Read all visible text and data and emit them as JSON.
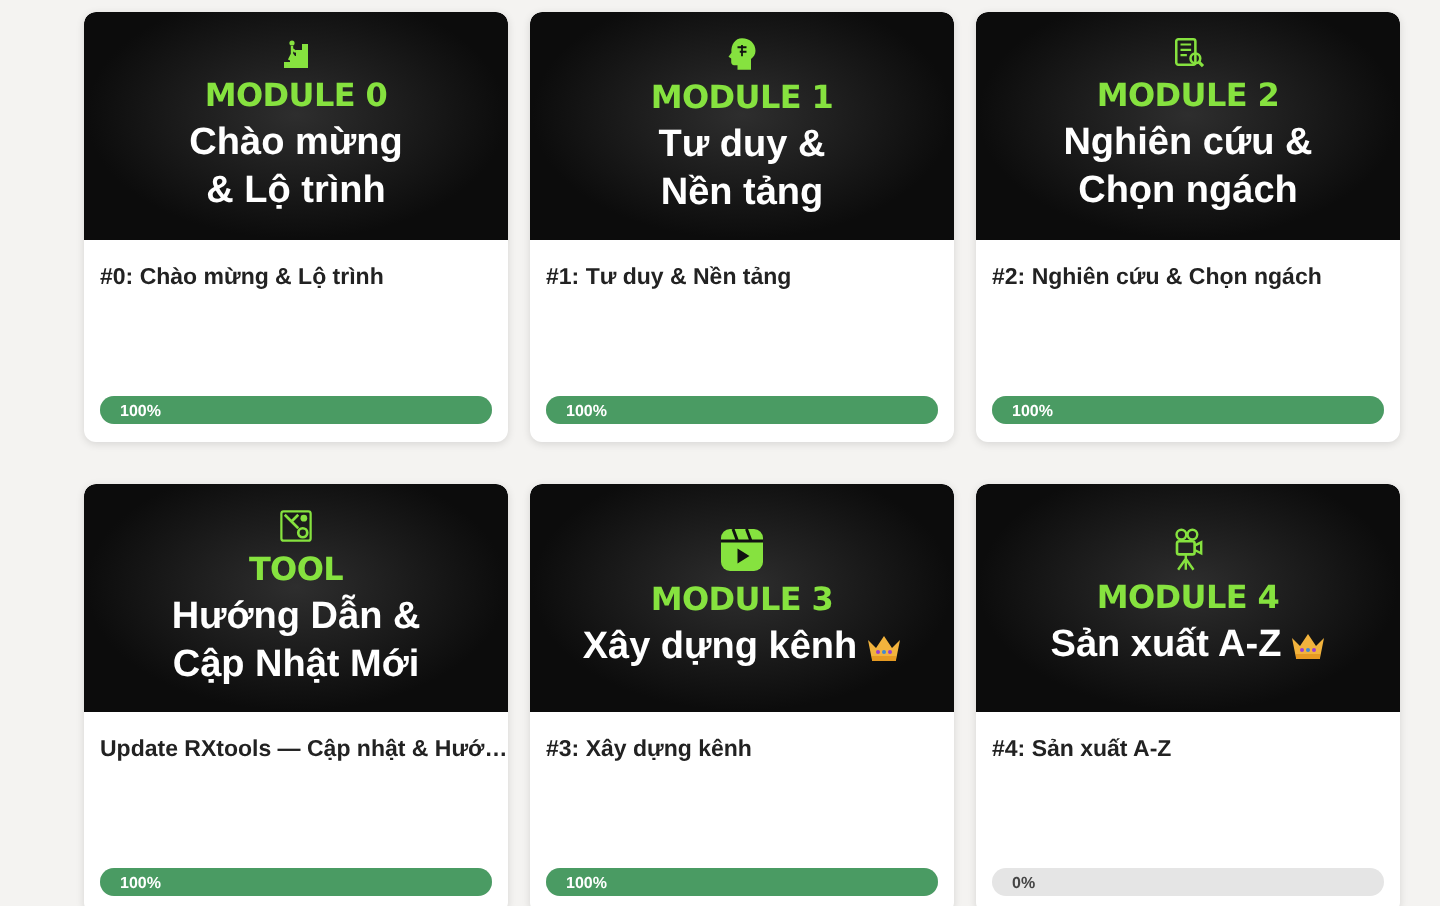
{
  "cards": [
    {
      "kind": "stairs",
      "label": "MODULE 0",
      "heading": "Chào mừng\n& Lộ trình",
      "crown": false,
      "title": "#0: Chào mừng & Lộ trình",
      "level": 1,
      "progress": "100%"
    },
    {
      "kind": "brain",
      "label": "MODULE 1",
      "heading": "Tư duy &\nNền tảng",
      "crown": false,
      "title": "#1: Tư duy & Nền tảng",
      "level": 1,
      "progress": "100%"
    },
    {
      "kind": "document",
      "label": "MODULE 2",
      "heading": "Nghiên cứu &\nChọn ngách",
      "crown": false,
      "title": "#2: Nghiên cứu & Chọn ngách",
      "level": 1,
      "progress": "100%"
    },
    {
      "kind": "tools",
      "label": "TOOL",
      "heading": "Hướng Dẫn &\nCập Nhật Mới",
      "crown": false,
      "title": "Update RXtools — Cập nhật & Hướ…",
      "level": 1,
      "progress": "100%"
    },
    {
      "kind": "video",
      "label": "MODULE 3",
      "heading": "Xây dựng kênh",
      "crown": true,
      "title": "#3: Xây dựng kênh",
      "level": 1,
      "progress": "100%"
    },
    {
      "kind": "camera",
      "label": "MODULE 4",
      "heading": "Sản xuất A-Z",
      "crown": true,
      "title": "#4: Sản xuất A-Z",
      "level": 0,
      "progress": "0%"
    }
  ]
}
